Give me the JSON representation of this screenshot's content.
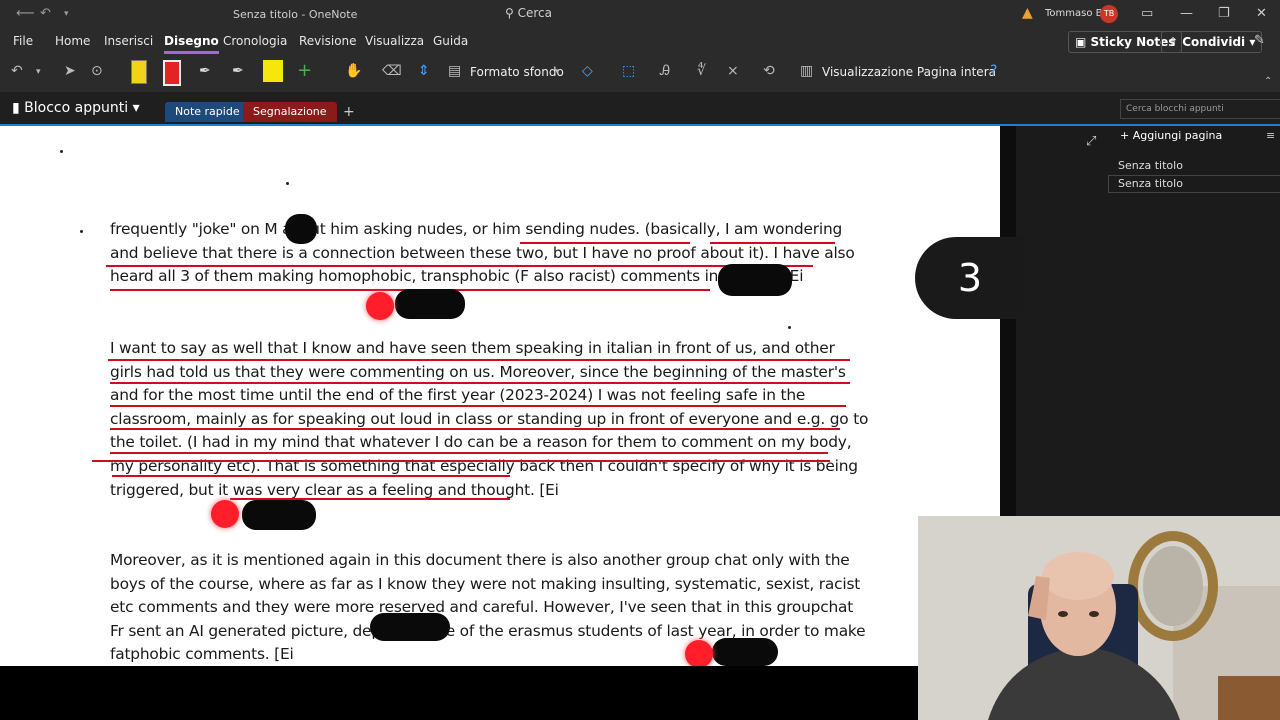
{
  "titlebar": {
    "title": "Senza titolo - OneNote",
    "search": "Cerca",
    "user": "Tommaso B",
    "initials": "TB"
  },
  "menu": {
    "file": "File",
    "home": "Home",
    "insert": "Inserisci",
    "draw": "Disegno",
    "history": "Cronologia",
    "review": "Revisione",
    "view": "Visualizza",
    "help": "Guida",
    "sticky": "Sticky Notes",
    "share": "Condividi"
  },
  "ribbon": {
    "format": "Formato sfondo",
    "fullpage": "Visualizzazione Pagina intera"
  },
  "notebook": {
    "name": "Blocco appunti",
    "tab1": "Note rapide",
    "tab2": "Segnalazione",
    "add": "+",
    "search_placeholder": "Cerca blocchi appunti"
  },
  "pages": {
    "add_label": "Aggiungi pagina",
    "items": [
      "Senza titolo",
      "Senza titolo"
    ]
  },
  "page_number": "3",
  "document": {
    "para1": "frequently \"joke\" on M      about him asking nudes, or him sending nudes. (basically, I am wondering and believe that there is a connection between these two, but I have no proof about it). I have also heard all 3 of them making homophobic, transphobic  (F              also racist) comments in person.  [Ei",
    "para2": "I want to say as well that I know and have seen them speaking in italian in front of us, and other girls had told us that they were commenting on us. Moreover, since the beginning of the master's and for the most time until the end of the first year (2023-2024) I was not feeling safe in the classroom, mainly as for speaking out loud in class or standing up in front of everyone and e.g. go to the toilet. (I had in my mind that whatever I do can be a reason for them to comment on my body, my personality etc). That is something that especially back then I couldn't specify of why it is being triggered, but it was very clear as a feeling and thought.  [Ei",
    "para3": "Moreover, as it is mentioned again in this document there is also another group chat only with the boys of the course, where as far as I know they were not making insulting, systematic, sexist, racist etc comments and they were more reserved and careful. However, I've seen that in this groupchat Fr              sent an AI generated picture, depicting one of the erasmus students of last year, in order to make fatphobic comments. [Ei"
  }
}
